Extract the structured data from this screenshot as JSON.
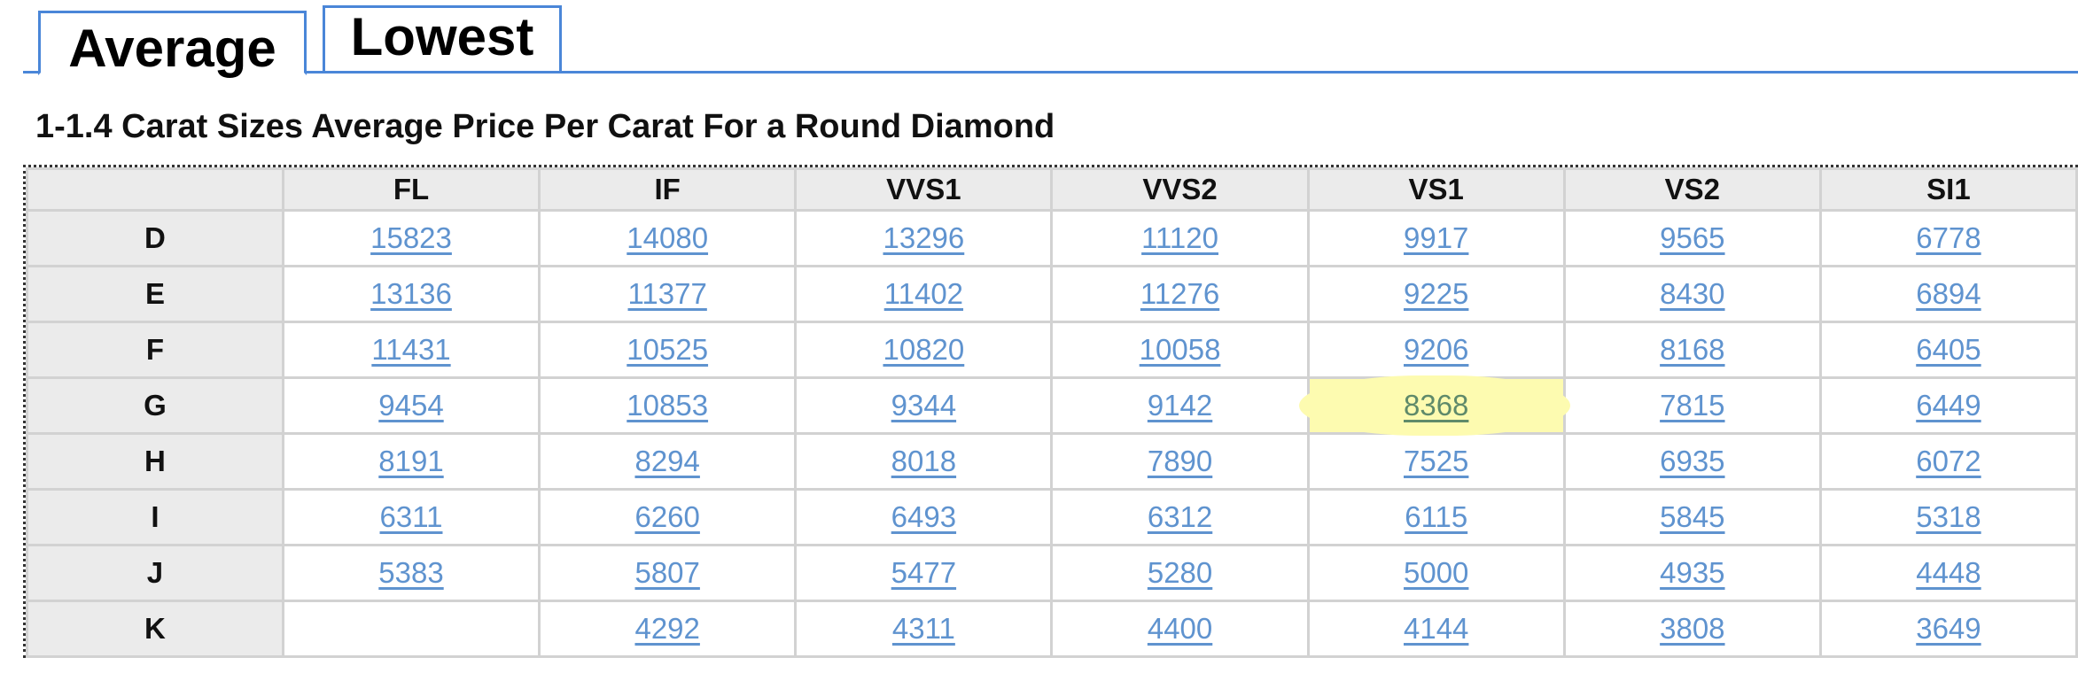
{
  "tabs": [
    {
      "label": "Average",
      "active": true
    },
    {
      "label": "Lowest",
      "active": false
    }
  ],
  "title": "1-1.4 Carat Sizes Average Price Per Carat For a Round Diamond",
  "table": {
    "columns": [
      "",
      "FL",
      "IF",
      "VVS1",
      "VVS2",
      "VS1",
      "VS2",
      "SI1"
    ],
    "rows": [
      {
        "color": "D",
        "values": [
          "15823",
          "14080",
          "13296",
          "11120",
          "9917",
          "9565",
          "6778"
        ]
      },
      {
        "color": "E",
        "values": [
          "13136",
          "11377",
          "11402",
          "11276",
          "9225",
          "8430",
          "6894"
        ]
      },
      {
        "color": "F",
        "values": [
          "11431",
          "10525",
          "10820",
          "10058",
          "9206",
          "8168",
          "6405"
        ]
      },
      {
        "color": "G",
        "values": [
          "9454",
          "10853",
          "9344",
          "9142",
          "8368",
          "7815",
          "6449"
        ]
      },
      {
        "color": "H",
        "values": [
          "8191",
          "8294",
          "8018",
          "7890",
          "7525",
          "6935",
          "6072"
        ]
      },
      {
        "color": "I",
        "values": [
          "6311",
          "6260",
          "6493",
          "6312",
          "6115",
          "5845",
          "5318"
        ]
      },
      {
        "color": "J",
        "values": [
          "5383",
          "5807",
          "5477",
          "5280",
          "5000",
          "4935",
          "4448"
        ]
      },
      {
        "color": "K",
        "values": [
          "",
          "4292",
          "4311",
          "4400",
          "4144",
          "3808",
          "3649"
        ]
      }
    ],
    "highlighted_cell": {
      "row": "G",
      "column": "VS1",
      "color": "#fdfbb0"
    }
  },
  "colors": {
    "tab_border": "#4a86d8",
    "link": "#5f93cf",
    "header_bg": "#ebebeb"
  }
}
